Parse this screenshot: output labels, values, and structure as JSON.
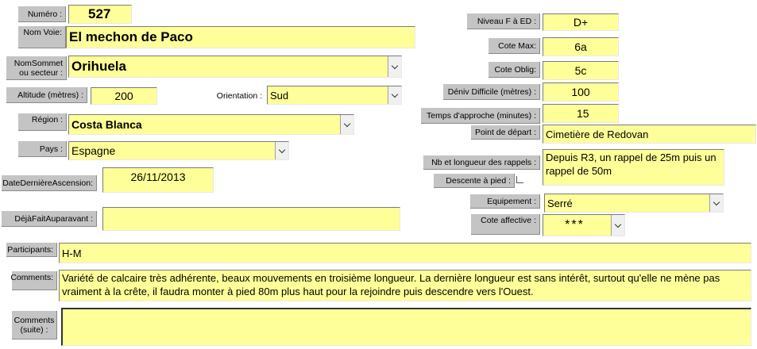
{
  "labels": {
    "numero": "Numéro :",
    "nom_voie": "Nom Voie:",
    "nom_sommet": "NomSommet ou secteur :",
    "altitude": "Altitude (mètres) :",
    "orientation": "Orientation :",
    "region": "Région :",
    "pays": "Pays :",
    "date_derniere": "DateDernièreAscension:",
    "deja_fait": "DéjàFaitAuparavant :",
    "participants": "Participants:",
    "comments": "Comments:",
    "comments_suite": "Comments (suite) :",
    "niveau": "Niveau F à ED :",
    "cote_max": "Cote Max:",
    "cote_oblig": "Cote Oblig:",
    "deniv": "Déniv Difficile (mètres) :",
    "temps": "Temps d'approche (minutes) :",
    "point_depart": "Point de départ :",
    "rappels": "Nb et longueur des rappels :",
    "descente": "Descente à pied :",
    "equipement": "Equipement :",
    "cote_affective": "Cote affective :"
  },
  "values": {
    "numero": "527",
    "nom_voie": "El mechon de Paco",
    "nom_sommet": "Orihuela",
    "altitude": "200",
    "orientation": "Sud",
    "region": "Costa Blanca",
    "pays": "Espagne",
    "date_derniere": "26/11/2013",
    "deja_fait": "",
    "participants": "H-M",
    "comments": "Variété de calcaire très adhérente, beaux mouvements en troisième longueur. La dernière longueur est sans intérêt, surtout qu'elle ne mène pas vraiment à la crête, il faudra monter à pied 80m plus haut pour la rejoindre puis descendre vers l'Ouest.",
    "comments_suite": "",
    "niveau": "D+",
    "cote_max": "6a",
    "cote_oblig": "5c",
    "deniv": "100",
    "temps": "15",
    "point_depart": "Cimetière de Redovan",
    "rappels": "Depuis R3, un  rappel de 25m puis un rappel de 50m",
    "descente_checked": false,
    "equipement": "Serré",
    "cote_affective": "***"
  },
  "colors": {
    "field_bg": "#ffff99",
    "label_bg": "#c4c4c4"
  }
}
